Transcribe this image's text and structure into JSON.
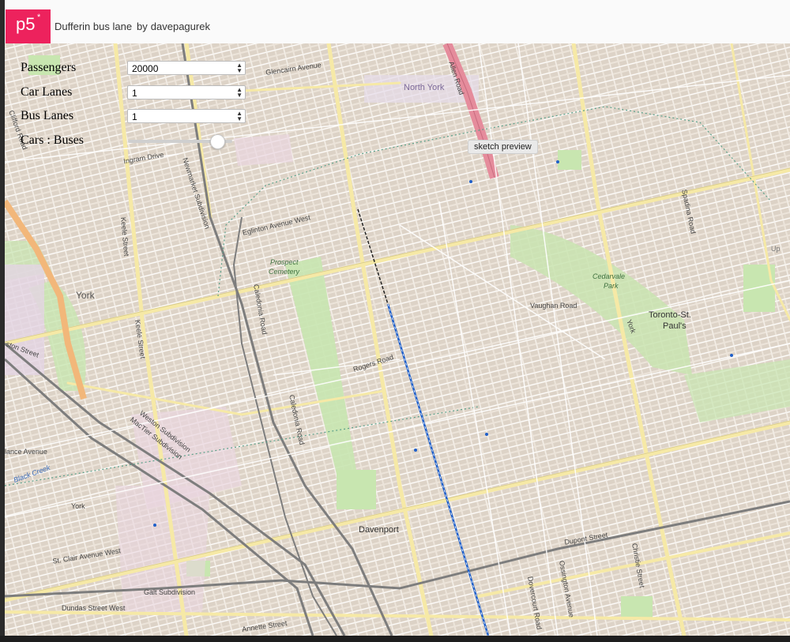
{
  "header": {
    "logo_text": "p5",
    "logo_star": "*",
    "sketch_title": "Dufferin bus lane",
    "by_label": "by",
    "author": "davepagurek"
  },
  "controls": {
    "passengers_label": "Passengers",
    "passengers_value": "20000",
    "car_lanes_label": "Car Lanes",
    "car_lanes_value": "1",
    "bus_lanes_label": "Bus Lanes",
    "bus_lanes_value": "1",
    "ratio_label": "Cars : Buses",
    "ratio_level": 0.85
  },
  "tooltip": {
    "text": "sketch preview"
  },
  "map_labels": {
    "glencairn": "Glencairn Avenue",
    "north_york": "North York",
    "allen_road": "Allen Road",
    "ingram": "Ingram Drive",
    "newmarket": "Newmarket Subdivision",
    "keele": "Keele Street",
    "eglinton": "Eglinton Avenue West",
    "prospect": "Prospect",
    "cemetery": "Cemetery",
    "caledonia1": "Caledonia Road",
    "caledonia2": "Caledonia Road",
    "rogers": "Rogers Road",
    "york": "York",
    "vaughan": "Vaughan Road",
    "cedarvale": "Cedarvale",
    "park": "Park",
    "toronto_st": "Toronto-St.",
    "pauls": "Paul's",
    "spadina": "Spadina Road",
    "york_small": "York",
    "weston": "Weston Subdivision",
    "mactier": "MacTier Subdivision",
    "davenport": "Davenport",
    "dupont": "Dupont Street",
    "st_clair": "St. Clair Avenue West",
    "galt": "Galt Subdivision",
    "dundas": "Dundas Street West",
    "dovercourt": "Dovercourt Road",
    "ossington": "Ossington Avenue",
    "christie": "Christie Street",
    "annette": "Annette Street",
    "black_creek": "Black Creek",
    "york_left": "York",
    "clifford": "Clifford Road",
    "keele2": "Keele Street",
    "ton_street": "ston Street",
    "lance": "lance Avenue",
    "up": "Up"
  },
  "colors": {
    "brand": "#ed225d",
    "map_bg": "#ece4da",
    "road_yellow": "#f6e9a6",
    "allen_red": "#e58c9c",
    "park_green": "#c8e6b0",
    "bus_route_blue": "#1f5fc9"
  }
}
